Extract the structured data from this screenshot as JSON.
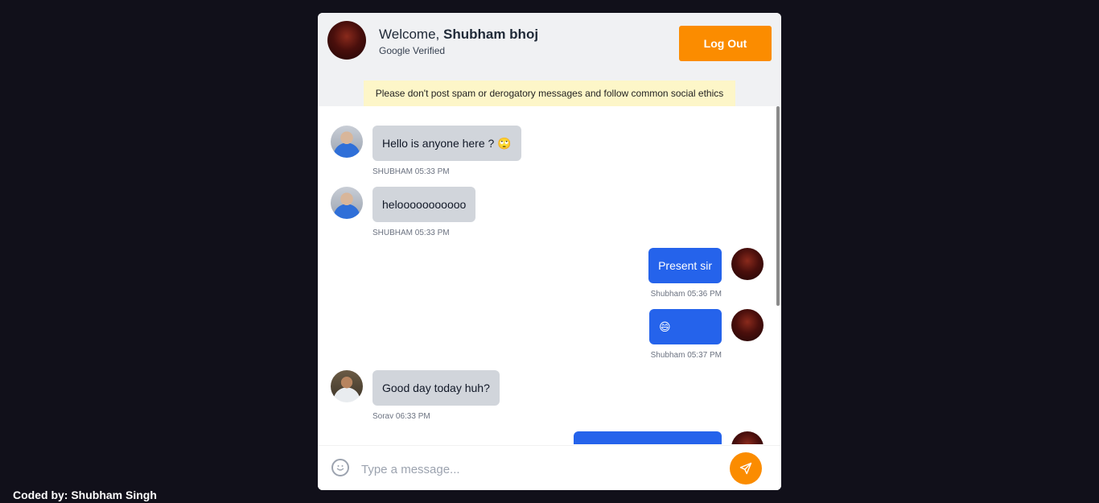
{
  "header": {
    "welcome_prefix": "Welcome, ",
    "user_name": "Shubham bhoj",
    "verified_text": "Google Verified",
    "logout_label": "Log Out"
  },
  "notice": "Please don't post spam or derogatory messages and follow common social ethics",
  "messages": [
    {
      "text": "Hello is anyone here ? 🙄",
      "sender": "SHUBHAM",
      "time": "05:33 PM",
      "outgoing": false
    },
    {
      "text": "helooooooooooo",
      "sender": "SHUBHAM",
      "time": "05:33 PM",
      "outgoing": false
    },
    {
      "text": "Present sir",
      "sender": "Shubham",
      "time": "05:36 PM",
      "outgoing": true
    },
    {
      "text": "😄",
      "sender": "Shubham",
      "time": "05:37 PM",
      "outgoing": true
    },
    {
      "text": "Good day today huh?",
      "sender": "Sorav",
      "time": "06:33 PM",
      "outgoing": false
    }
  ],
  "composer": {
    "placeholder": "Type a message..."
  },
  "footer": "Coded by: Shubham Singh",
  "colors": {
    "accent": "#fb8c00",
    "outgoing_bubble": "#2563eb",
    "incoming_bubble": "#d1d5db",
    "background": "#11101a"
  }
}
